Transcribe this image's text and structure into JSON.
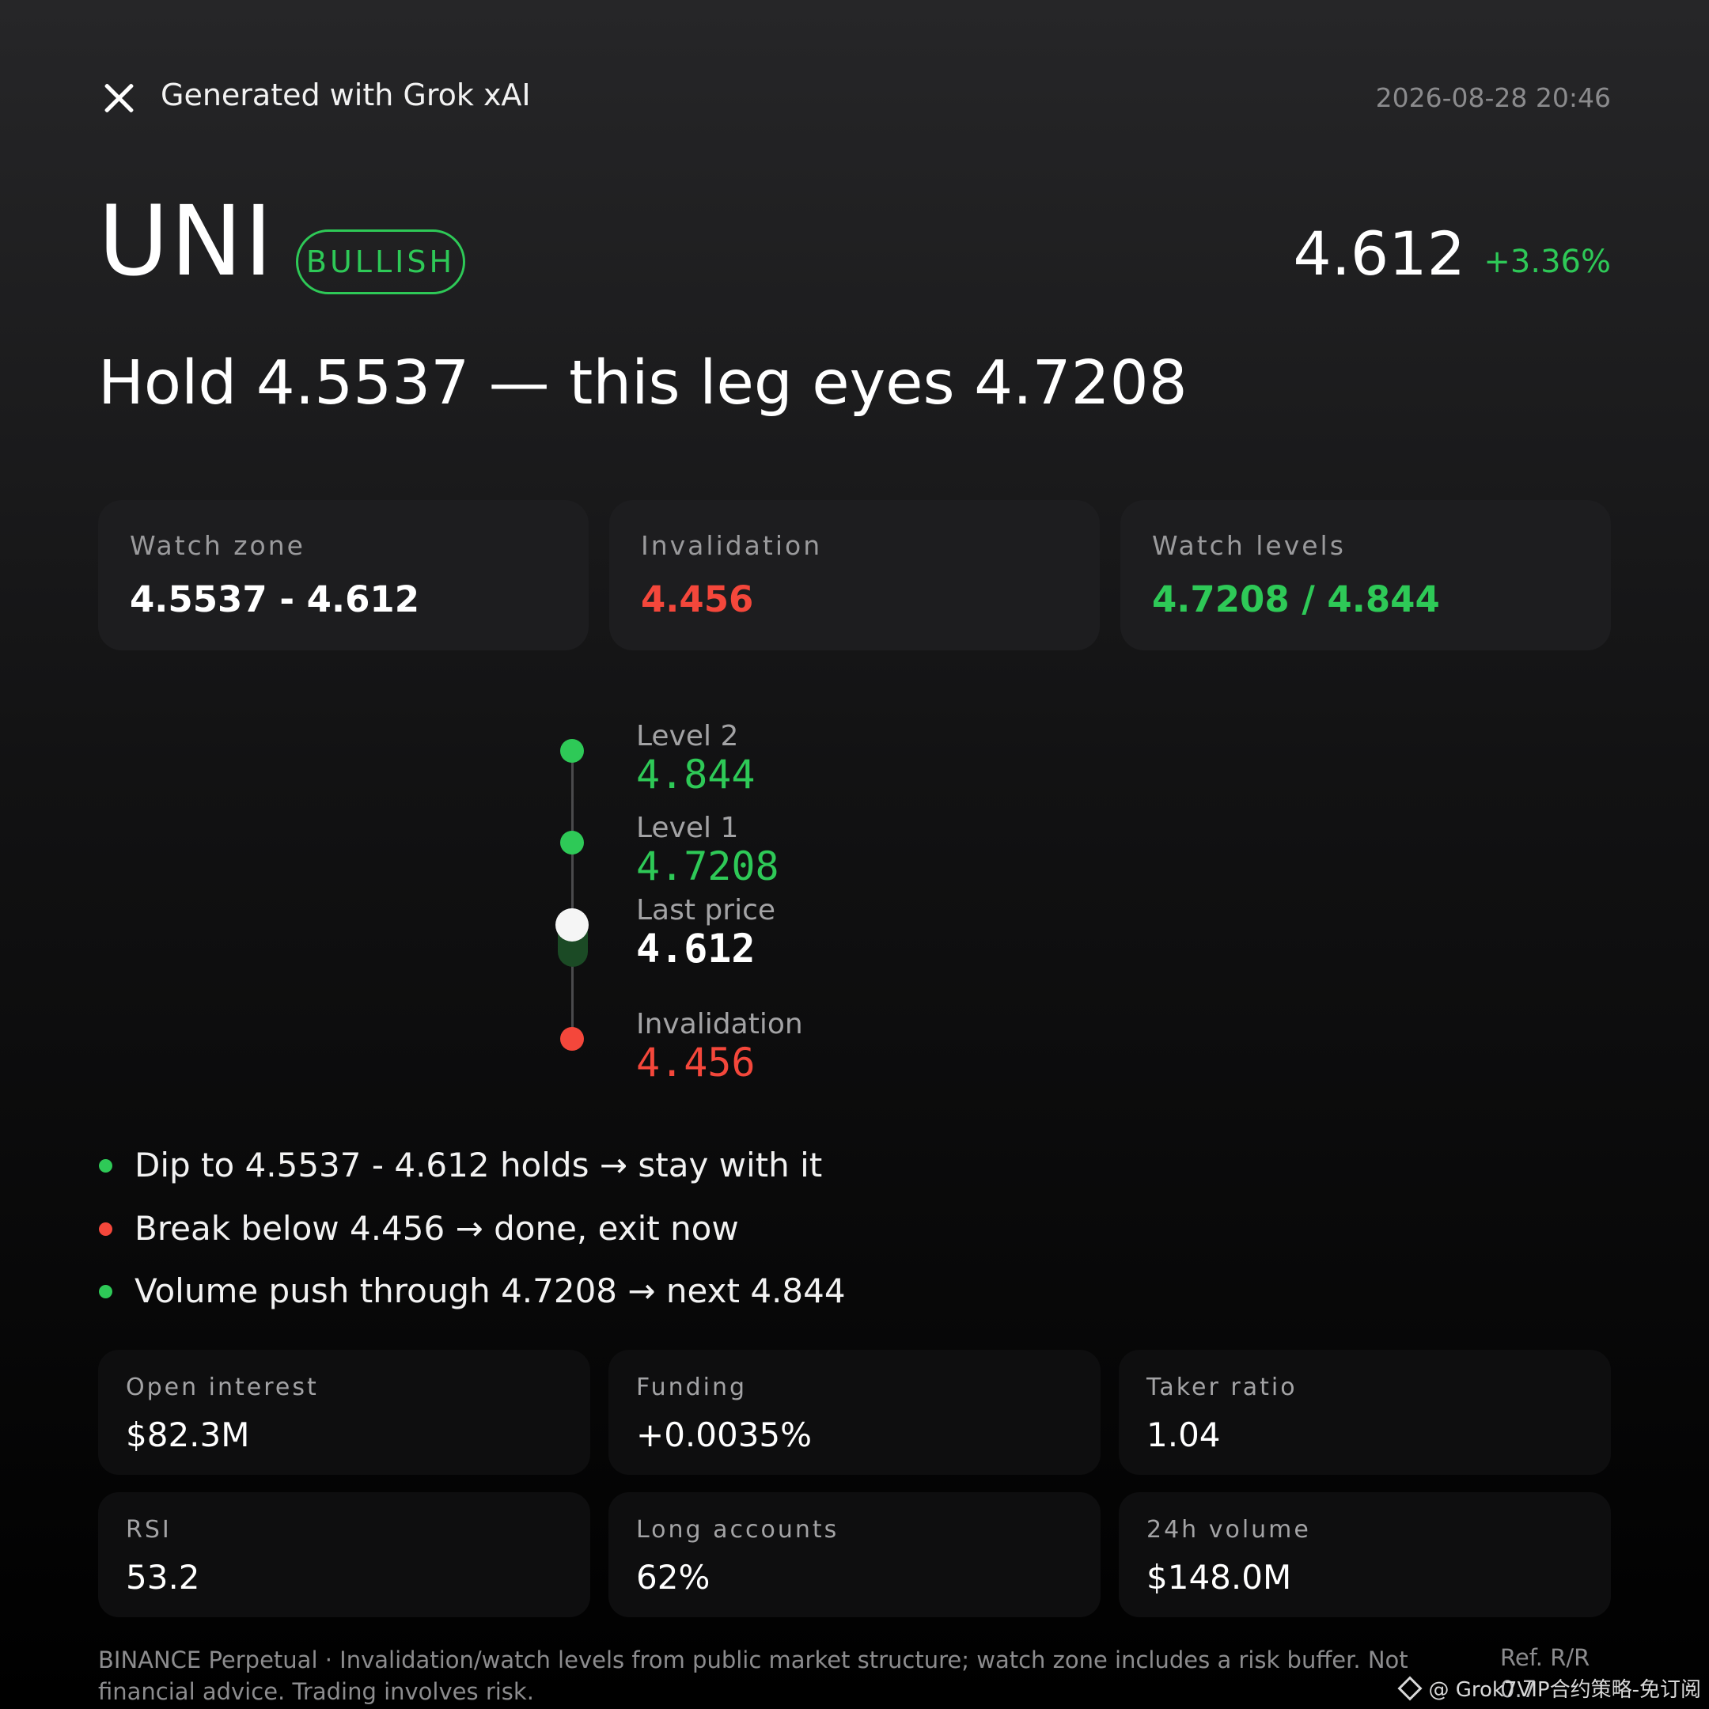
{
  "header": {
    "generated_label": "Generated with Grok xAI",
    "timestamp": "2026-08-28 20:46",
    "close_icon": "close-icon"
  },
  "asset": {
    "symbol": "UNI",
    "bias": "BULLISH",
    "price": "4.612",
    "change": "+3.36%"
  },
  "headline": "Hold 4.5537 — this leg eyes 4.7208",
  "summary_cards": [
    {
      "label": "Watch zone",
      "value": "4.5537 - 4.612"
    },
    {
      "label": "Invalidation",
      "value": "4.456"
    },
    {
      "label": "Watch levels",
      "value": "4.7208 / 4.844"
    }
  ],
  "ladder": [
    {
      "label": "Level 2",
      "value": "4.844",
      "color": "#2ec957"
    },
    {
      "label": "Level 1",
      "value": "4.7208",
      "color": "#2ec957"
    },
    {
      "label": "Last price",
      "value": "4.612",
      "color": "#ffffff"
    },
    {
      "label": "Invalidation",
      "value": "4.456",
      "color": "#f4473b"
    }
  ],
  "bullets": [
    {
      "text": "Dip to 4.5537 - 4.612 holds → stay with it",
      "color": "#2ec957"
    },
    {
      "text": "Break below 4.456 → done, exit now",
      "color": "#f4473b"
    },
    {
      "text": "Volume push through 4.7208 → next 4.844",
      "color": "#2ec957"
    }
  ],
  "metrics": [
    {
      "label": "Open interest",
      "value": "$82.3M"
    },
    {
      "label": "Funding",
      "value": "+0.0035%"
    },
    {
      "label": "Taker ratio",
      "value": "1.04"
    },
    {
      "label": "RSI",
      "value": "53.2"
    },
    {
      "label": "Long accounts",
      "value": "62%"
    },
    {
      "label": "24h volume",
      "value": "$148.0M"
    }
  ],
  "footer": {
    "disclaimer": "BINANCE Perpetual · Invalidation/watch levels from public market structure; watch zone includes a risk buffer. Not financial advice. Trading involves risk.",
    "ref_label": "Ref. R/R",
    "ref_value": "0.7"
  },
  "watermark": "@ Grok7VIP合约策略-免订阅",
  "colors": {
    "bullish": "#2ec957",
    "bearish": "#f4473b",
    "card_bg": "#1d1d1f",
    "metric_bg": "#0e0e0f"
  }
}
